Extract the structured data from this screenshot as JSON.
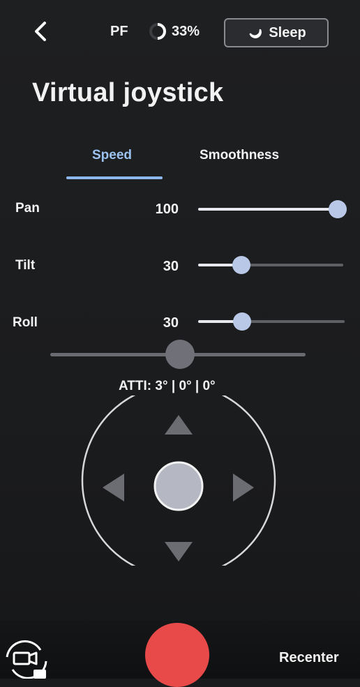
{
  "topbar": {
    "back_icon": "chevron-left-icon",
    "mode": "PF",
    "battery_icon": "battery-ring-icon",
    "battery": "33%",
    "battery_level": 0.33,
    "sleep_icon": "moon-icon",
    "sleep_label": "Sleep"
  },
  "title": "Virtual joystick",
  "tabs": [
    {
      "label": "Speed",
      "active": true
    },
    {
      "label": "Smoothness",
      "active": false
    }
  ],
  "sliders": [
    {
      "label": "Pan",
      "value": "100",
      "fraction": 1.0
    },
    {
      "label": "Tilt",
      "value": "30",
      "fraction": 0.3
    },
    {
      "label": "Roll",
      "value": "30",
      "fraction": 0.3
    }
  ],
  "attitude": "ATTI: 3° | 0° | 0°",
  "joystick": {
    "up_icon": "triangle-up-icon",
    "down_icon": "triangle-down-icon",
    "left_icon": "triangle-left-icon",
    "right_icon": "triangle-right-icon"
  },
  "bottom": {
    "camera_switch_icon": "camera-switch-icon",
    "record_icon": "record-button-icon",
    "recenter_label": "Recenter"
  },
  "colors": {
    "accent": "#8db8ec",
    "record": "#e84a4a",
    "background": "#1a1b1d"
  }
}
